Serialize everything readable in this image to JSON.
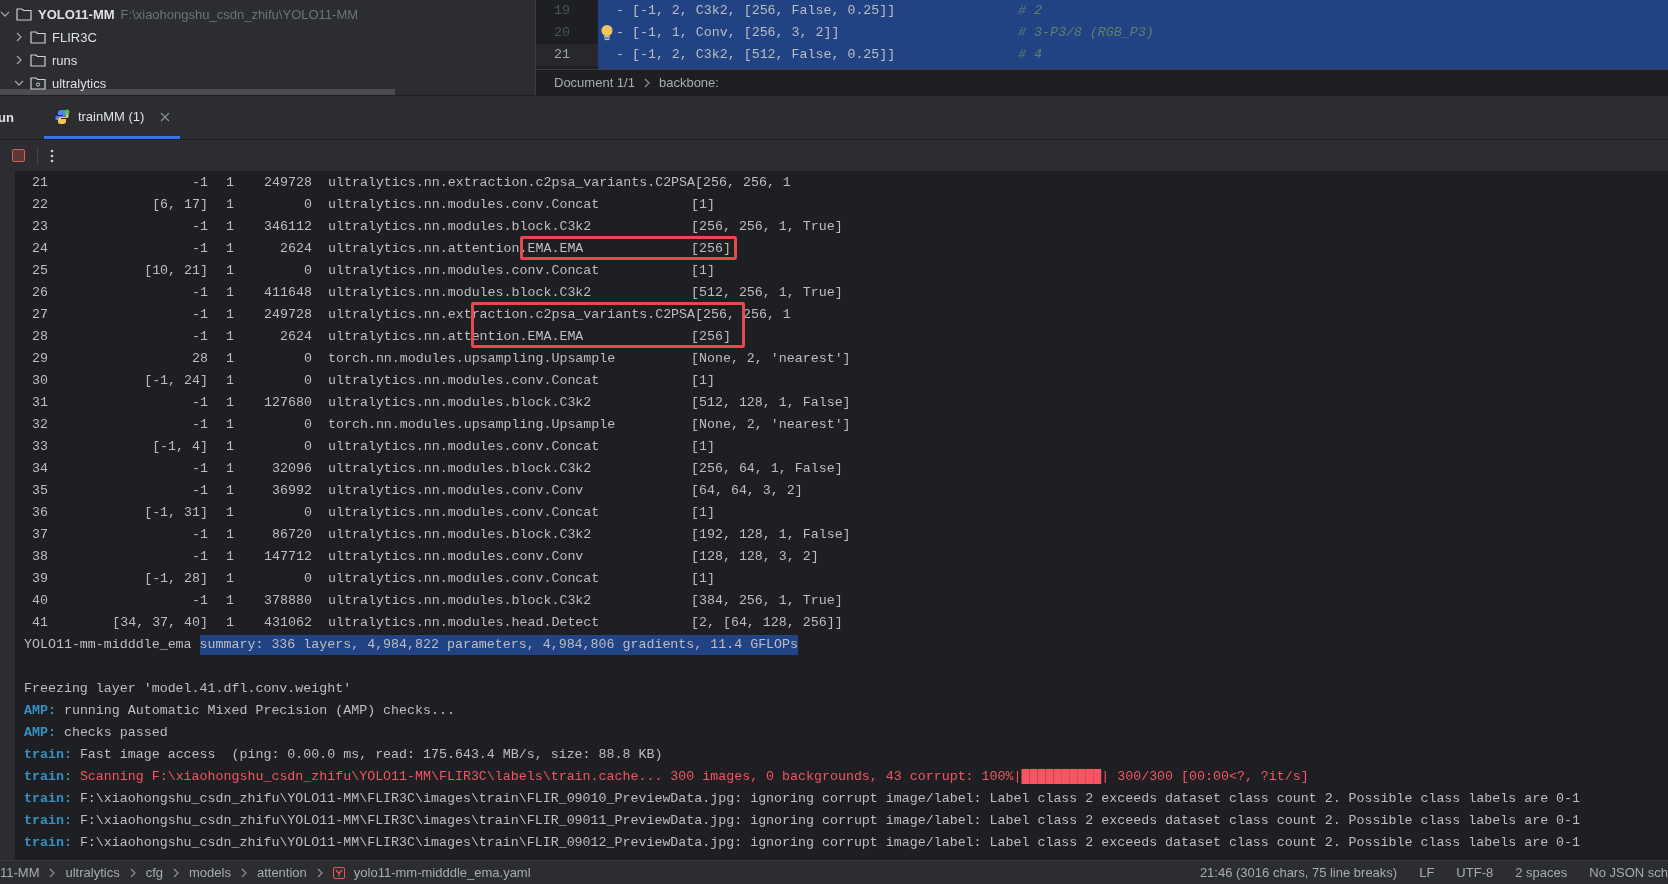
{
  "project_tree": {
    "label": "YOLO11-MM",
    "path": "F:\\xiaohongshu_csdn_zhifu\\YOLO11-MM",
    "expanded": true,
    "children": [
      {
        "label": "FLIR3C",
        "expanded": false,
        "kind": "folder"
      },
      {
        "label": "runs",
        "expanded": false,
        "kind": "folder"
      },
      {
        "label": "ultralytics",
        "expanded": true,
        "kind": "package"
      }
    ]
  },
  "editor": {
    "lines": [
      {
        "number": "19",
        "current": false,
        "bulb": false,
        "code": "- [-1, 2, C3k2, [256, False, 0.25]]",
        "comment": "# 2"
      },
      {
        "number": "20",
        "current": false,
        "bulb": true,
        "code": "- [-1, 1, Conv, [256, 3, 2]]",
        "comment": "# 3-P3/8 (RGB_P3)"
      },
      {
        "number": "21",
        "current": true,
        "bulb": false,
        "code": "- [-1, 2, C3k2, [512, False, 0.25]]",
        "comment": "# 4"
      }
    ],
    "breadcrumbs": [
      "Document 1/1",
      "backbone:"
    ]
  },
  "run_panel": {
    "title": "un",
    "tabs": [
      {
        "label": "trainMM (1)",
        "selected": true
      }
    ]
  },
  "console": {
    "rows": [
      [
        "21",
        "-1",
        "1",
        "249728",
        "ultralytics.nn.extraction.c2psa_variants.C2PSA",
        "[256, 256, 1"
      ],
      [
        "22",
        "[6, 17]",
        "1",
        "0",
        "ultralytics.nn.modules.conv.Concat",
        "[1]"
      ],
      [
        "23",
        "-1",
        "1",
        "346112",
        "ultralytics.nn.modules.block.C3k2",
        "[256, 256, 1, True]"
      ],
      [
        "24",
        "-1",
        "1",
        "2624",
        "ultralytics.nn.attention.EMA.EMA",
        "[256]"
      ],
      [
        "25",
        "[10, 21]",
        "1",
        "0",
        "ultralytics.nn.modules.conv.Concat",
        "[1]"
      ],
      [
        "26",
        "-1",
        "1",
        "411648",
        "ultralytics.nn.modules.block.C3k2",
        "[512, 256, 1, True]"
      ],
      [
        "27",
        "-1",
        "1",
        "249728",
        "ultralytics.nn.extraction.c2psa_variants.C2PSA",
        "[256, 256, 1"
      ],
      [
        "28",
        "-1",
        "1",
        "2624",
        "ultralytics.nn.attention.EMA.EMA",
        "[256]"
      ],
      [
        "29",
        "28",
        "1",
        "0",
        "torch.nn.modules.upsampling.Upsample",
        "[None, 2, 'nearest']"
      ],
      [
        "30",
        "[-1, 24]",
        "1",
        "0",
        "ultralytics.nn.modules.conv.Concat",
        "[1]"
      ],
      [
        "31",
        "-1",
        "1",
        "127680",
        "ultralytics.nn.modules.block.C3k2",
        "[512, 128, 1, False]"
      ],
      [
        "32",
        "-1",
        "1",
        "0",
        "torch.nn.modules.upsampling.Upsample",
        "[None, 2, 'nearest']"
      ],
      [
        "33",
        "[-1, 4]",
        "1",
        "0",
        "ultralytics.nn.modules.conv.Concat",
        "[1]"
      ],
      [
        "34",
        "-1",
        "1",
        "32096",
        "ultralytics.nn.modules.block.C3k2",
        "[256, 64, 1, False]"
      ],
      [
        "35",
        "-1",
        "1",
        "36992",
        "ultralytics.nn.modules.conv.Conv",
        "[64, 64, 3, 2]"
      ],
      [
        "36",
        "[-1, 31]",
        "1",
        "0",
        "ultralytics.nn.modules.conv.Concat",
        "[1]"
      ],
      [
        "37",
        "-1",
        "1",
        "86720",
        "ultralytics.nn.modules.block.C3k2",
        "[192, 128, 1, False]"
      ],
      [
        "38",
        "-1",
        "1",
        "147712",
        "ultralytics.nn.modules.conv.Conv",
        "[128, 128, 3, 2]"
      ],
      [
        "39",
        "[-1, 28]",
        "1",
        "0",
        "ultralytics.nn.modules.conv.Concat",
        "[1]"
      ],
      [
        "40",
        "-1",
        "1",
        "378880",
        "ultralytics.nn.modules.block.C3k2",
        "[384, 256, 1, True]"
      ],
      [
        "41",
        "[34, 37, 40]",
        "1",
        "431062",
        "ultralytics.nn.modules.head.Detect",
        "[2, [64, 128, 256]]"
      ]
    ],
    "summary": {
      "name": "YOLO11-mm-midddle_ema",
      "selection": "summary: 336 layers, 4,984,822 parameters, 4,984,806 gradients, 11.4 GFLOPs"
    },
    "log": [
      {
        "kind": "plain",
        "text": "Freezing layer 'model.41.dfl.conv.weight'"
      },
      {
        "kind": "tagged",
        "tag": "AMP:",
        "text": "running Automatic Mixed Precision (AMP) checks..."
      },
      {
        "kind": "tagged",
        "tag": "AMP:",
        "text": "checks passed"
      },
      {
        "kind": "tagged",
        "tag": "train:",
        "text": "Fast image access  (ping: 0.00.0 ms, read: 175.643.4 MB/s, size: 88.8 KB)"
      },
      {
        "kind": "error",
        "tag": "train:",
        "text": "Scanning F:\\xiaohongshu_csdn_zhifu\\YOLO11-MM\\FLIR3C\\labels\\train.cache... 300 images, 0 backgrounds, 43 corrupt: 100%|██████████| 300/300 [00:00<?, ?it/s]"
      },
      {
        "kind": "tagged",
        "tag": "train:",
        "text": "F:\\xiaohongshu_csdn_zhifu\\YOLO11-MM\\FLIR3C\\images\\train\\FLIR_09010_PreviewData.jpg: ignoring corrupt image/label: Label class 2 exceeds dataset class count 2. Possible class labels are 0-1"
      },
      {
        "kind": "tagged",
        "tag": "train:",
        "text": "F:\\xiaohongshu_csdn_zhifu\\YOLO11-MM\\FLIR3C\\images\\train\\FLIR_09011_PreviewData.jpg: ignoring corrupt image/label: Label class 2 exceeds dataset class count 2. Possible class labels are 0-1"
      },
      {
        "kind": "tagged",
        "tag": "train:",
        "text": "F:\\xiaohongshu_csdn_zhifu\\YOLO11-MM\\FLIR3C\\images\\train\\FLIR_09012_PreviewData.jpg: ignoring corrupt image/label: Label class 2 exceeds dataset class count 2. Possible class labels are 0-1"
      }
    ]
  },
  "status_bar": {
    "path": [
      "11-MM",
      "ultralytics",
      "cfg",
      "models",
      "attention",
      "yolo11-mm-midddle_ema.yaml"
    ],
    "items": [
      "21:46 (3016 chars, 75 line breaks)",
      "LF",
      "UTF-8",
      "2 spaces",
      "No JSON sch"
    ]
  }
}
